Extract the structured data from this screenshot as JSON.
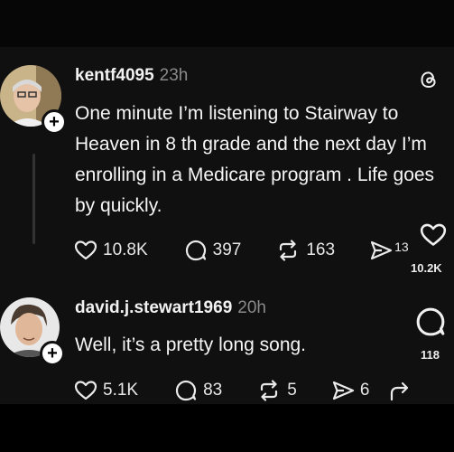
{
  "posts": [
    {
      "username": "kentf4095",
      "time": "23h",
      "text": "One minute I’m listening to Stairway to Heaven in 8 th grade and the next day I’m enrolling in a Medicare program . Life goes by quickly.",
      "likes": "10.8K",
      "replies": "397",
      "reposts": "163",
      "shares": "13",
      "side_count": "10.2K"
    },
    {
      "username": "david.j.stewart1969",
      "time": "20h",
      "text": "Well, it’s a pretty long song.",
      "likes": "5.1K",
      "replies": "83",
      "reposts": "5",
      "shares": "6",
      "side_count": "118"
    }
  ],
  "icons": {
    "app_logo": "threads-logo-icon",
    "like": "heart-icon",
    "reply": "speech-bubble-icon",
    "repost": "repost-icon",
    "share": "send-icon",
    "side_like": "heart-icon",
    "side_reply": "speech-bubble-icon",
    "side_share": "share-arrow-icon"
  },
  "colors": {
    "background": "#101010",
    "text": "#f5f5f5",
    "muted": "#8a8a8a"
  }
}
